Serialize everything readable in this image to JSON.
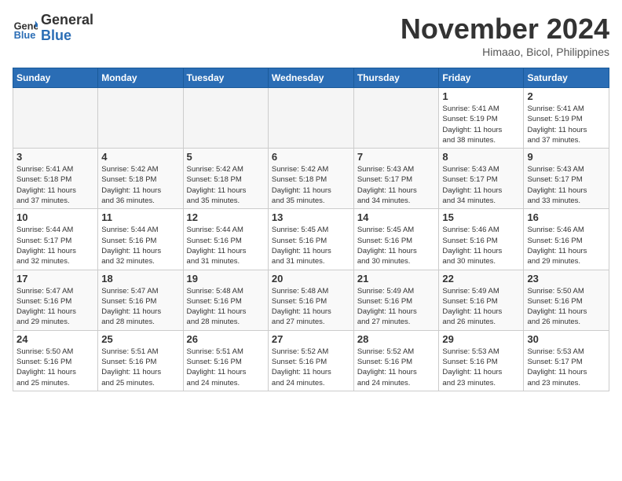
{
  "header": {
    "logo_general": "General",
    "logo_blue": "Blue",
    "month_title": "November 2024",
    "location": "Himaao, Bicol, Philippines"
  },
  "weekdays": [
    "Sunday",
    "Monday",
    "Tuesday",
    "Wednesday",
    "Thursday",
    "Friday",
    "Saturday"
  ],
  "weeks": [
    [
      {
        "day": "",
        "info": ""
      },
      {
        "day": "",
        "info": ""
      },
      {
        "day": "",
        "info": ""
      },
      {
        "day": "",
        "info": ""
      },
      {
        "day": "",
        "info": ""
      },
      {
        "day": "1",
        "info": "Sunrise: 5:41 AM\nSunset: 5:19 PM\nDaylight: 11 hours\nand 38 minutes."
      },
      {
        "day": "2",
        "info": "Sunrise: 5:41 AM\nSunset: 5:19 PM\nDaylight: 11 hours\nand 37 minutes."
      }
    ],
    [
      {
        "day": "3",
        "info": "Sunrise: 5:41 AM\nSunset: 5:18 PM\nDaylight: 11 hours\nand 37 minutes."
      },
      {
        "day": "4",
        "info": "Sunrise: 5:42 AM\nSunset: 5:18 PM\nDaylight: 11 hours\nand 36 minutes."
      },
      {
        "day": "5",
        "info": "Sunrise: 5:42 AM\nSunset: 5:18 PM\nDaylight: 11 hours\nand 35 minutes."
      },
      {
        "day": "6",
        "info": "Sunrise: 5:42 AM\nSunset: 5:18 PM\nDaylight: 11 hours\nand 35 minutes."
      },
      {
        "day": "7",
        "info": "Sunrise: 5:43 AM\nSunset: 5:17 PM\nDaylight: 11 hours\nand 34 minutes."
      },
      {
        "day": "8",
        "info": "Sunrise: 5:43 AM\nSunset: 5:17 PM\nDaylight: 11 hours\nand 34 minutes."
      },
      {
        "day": "9",
        "info": "Sunrise: 5:43 AM\nSunset: 5:17 PM\nDaylight: 11 hours\nand 33 minutes."
      }
    ],
    [
      {
        "day": "10",
        "info": "Sunrise: 5:44 AM\nSunset: 5:17 PM\nDaylight: 11 hours\nand 32 minutes."
      },
      {
        "day": "11",
        "info": "Sunrise: 5:44 AM\nSunset: 5:16 PM\nDaylight: 11 hours\nand 32 minutes."
      },
      {
        "day": "12",
        "info": "Sunrise: 5:44 AM\nSunset: 5:16 PM\nDaylight: 11 hours\nand 31 minutes."
      },
      {
        "day": "13",
        "info": "Sunrise: 5:45 AM\nSunset: 5:16 PM\nDaylight: 11 hours\nand 31 minutes."
      },
      {
        "day": "14",
        "info": "Sunrise: 5:45 AM\nSunset: 5:16 PM\nDaylight: 11 hours\nand 30 minutes."
      },
      {
        "day": "15",
        "info": "Sunrise: 5:46 AM\nSunset: 5:16 PM\nDaylight: 11 hours\nand 30 minutes."
      },
      {
        "day": "16",
        "info": "Sunrise: 5:46 AM\nSunset: 5:16 PM\nDaylight: 11 hours\nand 29 minutes."
      }
    ],
    [
      {
        "day": "17",
        "info": "Sunrise: 5:47 AM\nSunset: 5:16 PM\nDaylight: 11 hours\nand 29 minutes."
      },
      {
        "day": "18",
        "info": "Sunrise: 5:47 AM\nSunset: 5:16 PM\nDaylight: 11 hours\nand 28 minutes."
      },
      {
        "day": "19",
        "info": "Sunrise: 5:48 AM\nSunset: 5:16 PM\nDaylight: 11 hours\nand 28 minutes."
      },
      {
        "day": "20",
        "info": "Sunrise: 5:48 AM\nSunset: 5:16 PM\nDaylight: 11 hours\nand 27 minutes."
      },
      {
        "day": "21",
        "info": "Sunrise: 5:49 AM\nSunset: 5:16 PM\nDaylight: 11 hours\nand 27 minutes."
      },
      {
        "day": "22",
        "info": "Sunrise: 5:49 AM\nSunset: 5:16 PM\nDaylight: 11 hours\nand 26 minutes."
      },
      {
        "day": "23",
        "info": "Sunrise: 5:50 AM\nSunset: 5:16 PM\nDaylight: 11 hours\nand 26 minutes."
      }
    ],
    [
      {
        "day": "24",
        "info": "Sunrise: 5:50 AM\nSunset: 5:16 PM\nDaylight: 11 hours\nand 25 minutes."
      },
      {
        "day": "25",
        "info": "Sunrise: 5:51 AM\nSunset: 5:16 PM\nDaylight: 11 hours\nand 25 minutes."
      },
      {
        "day": "26",
        "info": "Sunrise: 5:51 AM\nSunset: 5:16 PM\nDaylight: 11 hours\nand 24 minutes."
      },
      {
        "day": "27",
        "info": "Sunrise: 5:52 AM\nSunset: 5:16 PM\nDaylight: 11 hours\nand 24 minutes."
      },
      {
        "day": "28",
        "info": "Sunrise: 5:52 AM\nSunset: 5:16 PM\nDaylight: 11 hours\nand 24 minutes."
      },
      {
        "day": "29",
        "info": "Sunrise: 5:53 AM\nSunset: 5:16 PM\nDaylight: 11 hours\nand 23 minutes."
      },
      {
        "day": "30",
        "info": "Sunrise: 5:53 AM\nSunset: 5:17 PM\nDaylight: 11 hours\nand 23 minutes."
      }
    ]
  ]
}
